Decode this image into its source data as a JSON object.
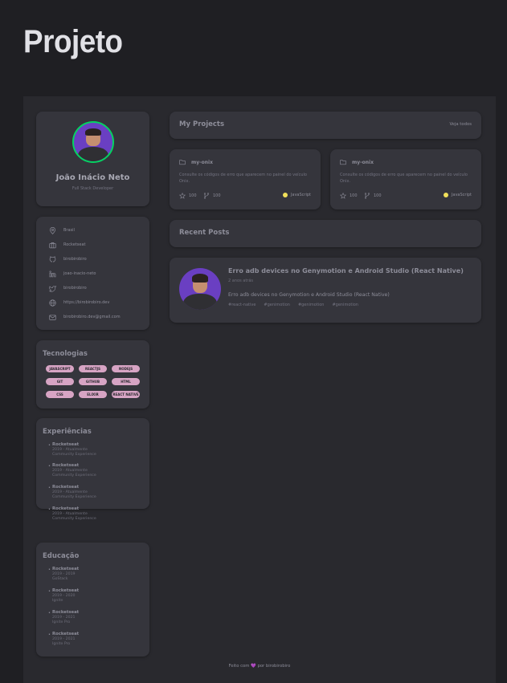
{
  "page": {
    "title": "Projeto"
  },
  "colors": {
    "background": "#1f1f23",
    "card": "#35353c",
    "accent_green": "#04d361",
    "tag": "#d7a4c4",
    "js_dot": "#f1e05a",
    "heart": "#a855f7"
  },
  "profile": {
    "name": "João Inácio Neto",
    "role": "Full Stack Developer"
  },
  "info": [
    {
      "icon": "location-pin-icon",
      "text": "Brasil"
    },
    {
      "icon": "briefcase-icon",
      "text": "Rocketseat"
    },
    {
      "icon": "github-icon",
      "text": "birobirobiro"
    },
    {
      "icon": "linkedin-icon",
      "text": "joao-inacio-neto"
    },
    {
      "icon": "twitter-icon",
      "text": "birobirobiro"
    },
    {
      "icon": "globe-icon",
      "text": "https://birobirobiro.dev"
    },
    {
      "icon": "mail-icon",
      "text": "birobirobiro.dev@gmail.com"
    }
  ],
  "techs": {
    "title": "Tecnologias",
    "items": [
      "JAVASCRIPT",
      "REACTJS",
      "NODEJS",
      "GIT",
      "GITHUB",
      "HTML",
      "CSS",
      "ELIXIR",
      "REACT NATIVE"
    ]
  },
  "experiences": {
    "title": "Experiências",
    "items": [
      {
        "company": "Rocketseat",
        "period": "2019 - Atualmente",
        "role": "Community Experience"
      },
      {
        "company": "Rocketseat",
        "period": "2019 - Atualmente",
        "role": "Community Experience"
      },
      {
        "company": "Rocketseat",
        "period": "2019 - Atualmente",
        "role": "Community Experience"
      },
      {
        "company": "Rocketseat",
        "period": "2019 - Atualmente",
        "role": "Community Experience"
      }
    ]
  },
  "education": {
    "title": "Educação",
    "items": [
      {
        "company": "Rocketseat",
        "period": "2019 - 2019",
        "role": "GoStack"
      },
      {
        "company": "Rocketseat",
        "period": "2019 - 2020",
        "role": "Ignite"
      },
      {
        "company": "Rocketseat",
        "period": "2019 - 2021",
        "role": "Ignite Pro"
      },
      {
        "company": "Rocketseat",
        "period": "2019 - 2021",
        "role": "Ignite Pro"
      }
    ]
  },
  "projects": {
    "title": "My Projects",
    "see_all": "Veja todos",
    "repos": [
      {
        "name": "my-onix",
        "description": "Consulte os códigos de erro que aparecem no painel do veículo Onix.",
        "stars": "100",
        "forks": "100",
        "language": "JavaScript"
      },
      {
        "name": "my-onix",
        "description": "Consulte os códigos de erro que aparecem no painel do veículo Onix.",
        "stars": "100",
        "forks": "100",
        "language": "JavaScript"
      }
    ]
  },
  "recent_posts": {
    "title": "Recent Posts",
    "post": {
      "title": "Erro adb devices no Genymotion e Android Studio (React Native)",
      "date": "2 anos atrás",
      "excerpt": "Erro adb devices no Genymotion e Android Studio (React Native)",
      "tags": [
        "#react-native",
        "#genimotion",
        "#genimotion",
        "#genimotion"
      ]
    }
  },
  "footer": {
    "prefix": "Feito com",
    "heart": "💜",
    "suffix": "por birobirobiro"
  }
}
